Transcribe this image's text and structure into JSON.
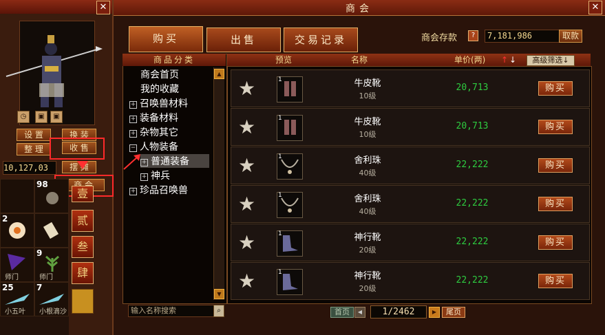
{
  "window": {
    "title": "商会",
    "close_label": "✕"
  },
  "left_panel": {
    "close_label": "✕",
    "buttons": {
      "settings": "设 置",
      "swap": "换 装",
      "organize": "整 理",
      "sell": "收 售",
      "stall": "摆 摊",
      "bank": "商 会"
    },
    "money": "10,127,03",
    "numtabs": [
      "壹",
      "贰",
      "叁",
      "肆"
    ],
    "slots": [
      {
        "num": "",
        "label": ""
      },
      {
        "num": "98",
        "label": ""
      },
      {
        "num": "2",
        "label": ""
      },
      {
        "num": "",
        "label": ""
      },
      {
        "num": "",
        "label": "师门"
      },
      {
        "num": "9",
        "label": "师门"
      },
      {
        "num": "25",
        "label": "小五叶"
      },
      {
        "num": "7",
        "label": "小根滴沙"
      }
    ]
  },
  "tabs": [
    {
      "label": "购买"
    },
    {
      "label": "出售"
    },
    {
      "label": "交易记录"
    }
  ],
  "bank": {
    "label": "商会存款",
    "help": "?",
    "value": "7,181,986",
    "withdraw": "取款"
  },
  "category": {
    "header": "商品分类",
    "items": [
      {
        "label": "商会首页",
        "marker": ""
      },
      {
        "label": "我的收藏",
        "marker": ""
      },
      {
        "label": "召唤兽材料",
        "marker": "+"
      },
      {
        "label": "装备材料",
        "marker": "+"
      },
      {
        "label": "杂物其它",
        "marker": "+"
      },
      {
        "label": "人物装备",
        "marker": "−"
      },
      {
        "label": "普通装备",
        "marker": "+"
      },
      {
        "label": "神兵",
        "marker": "+"
      },
      {
        "label": "珍品召唤兽",
        "marker": "+"
      }
    ]
  },
  "list": {
    "headers": {
      "preview": "预览",
      "name": "名称",
      "price": "单价(两)",
      "sort_up": "↑",
      "sort_down": "↓",
      "advanced": "高级筛选↓"
    },
    "buy_label": "购买",
    "rows": [
      {
        "num": "1",
        "name": "牛皮靴",
        "level": "10级",
        "price": "20,713"
      },
      {
        "num": "1",
        "name": "牛皮靴",
        "level": "10级",
        "price": "20,713"
      },
      {
        "num": "1",
        "name": "舍利珠",
        "level": "40级",
        "price": "22,222"
      },
      {
        "num": "1",
        "name": "舍利珠",
        "level": "40级",
        "price": "22,222"
      },
      {
        "num": "1",
        "name": "神行靴",
        "level": "20级",
        "price": "22,222"
      },
      {
        "num": "1",
        "name": "神行靴",
        "level": "20级",
        "price": "22,222"
      }
    ]
  },
  "footer": {
    "search_placeholder": "输入名称搜索",
    "first": "首页",
    "page": "1/2462",
    "last": "尾页"
  },
  "colors": {
    "price": "#2ecc40",
    "accent": "#7a260a",
    "highlight_box": "#ff2a2a"
  }
}
